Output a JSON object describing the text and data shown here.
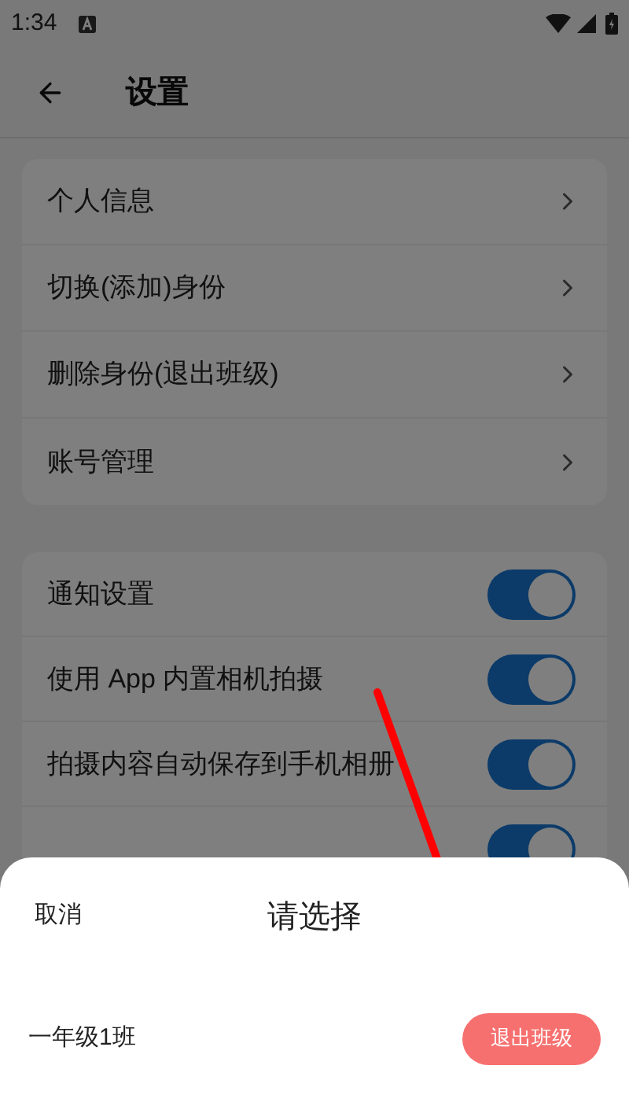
{
  "status_bar": {
    "time": "1:34"
  },
  "header": {
    "title": "设置"
  },
  "account_items": [
    {
      "label": "个人信息"
    },
    {
      "label": "切换(添加)身份"
    },
    {
      "label": "删除身份(退出班级)"
    },
    {
      "label": "账号管理"
    }
  ],
  "toggles": [
    {
      "label": "通知设置",
      "on": true
    },
    {
      "label": "使用 App 内置相机拍摄",
      "on": true
    },
    {
      "label": "拍摄内容自动保存到手机相册",
      "on": true
    },
    {
      "on": true
    }
  ],
  "sheet": {
    "cancel": "取消",
    "title": "请选择",
    "rows": [
      {
        "label": "一年级1班",
        "action": "退出班级"
      }
    ]
  }
}
